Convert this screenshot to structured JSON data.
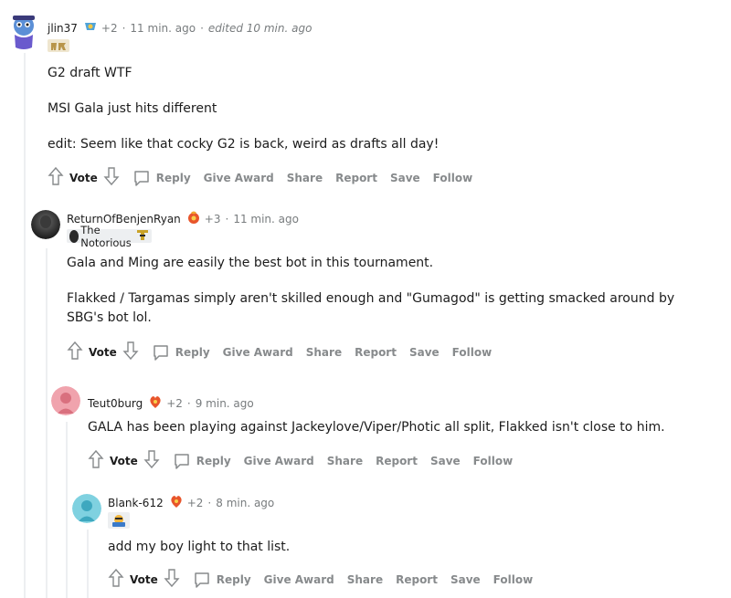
{
  "comments": [
    {
      "username": "jlin37",
      "award_count": "+2",
      "time": "11 min. ago",
      "edited": "edited 10 min. ago",
      "paragraphs": [
        "G2 draft WTF",
        "MSI Gala just hits different",
        "edit: Seem like that cocky G2 is back, weird as drafts all day!"
      ]
    },
    {
      "username": "ReturnOfBenjenRyan",
      "award_count": "+3",
      "time": "11 min. ago",
      "flair": "The Notorious",
      "paragraphs": [
        "Gala and Ming are easily the best bot in this tournament.",
        "Flakked / Targamas simply aren't skilled enough and \"Gumagod\" is getting smacked around by SBG's bot lol."
      ]
    },
    {
      "username": "Teut0burg",
      "award_count": "+2",
      "time": "9 min. ago",
      "paragraphs": [
        "GALA has been playing against Jackeylove/Viper/Photic all split, Flakked isn't close to him."
      ]
    },
    {
      "username": "Blank-612",
      "award_count": "+2",
      "time": "8 min. ago",
      "paragraphs": [
        "add my boy light to that list."
      ]
    }
  ],
  "actions": {
    "vote": "Vote",
    "reply": "Reply",
    "give_award": "Give Award",
    "share": "Share",
    "report": "Report",
    "save": "Save",
    "follow": "Follow"
  },
  "separator": "·",
  "colors": {
    "meta": "#787c7e",
    "action": "#878a8c",
    "thread_line": "#edeff1",
    "text": "#1c1c1c"
  }
}
